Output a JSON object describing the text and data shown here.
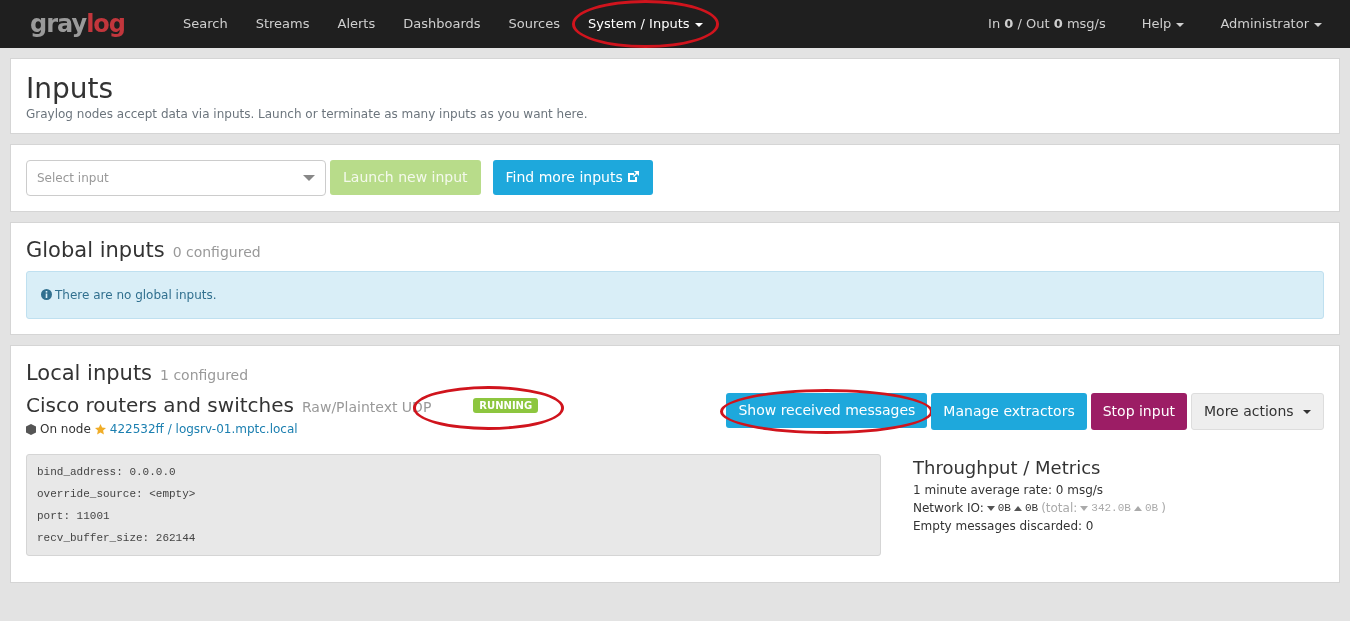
{
  "navbar": {
    "logo_parts": [
      "gray",
      "log"
    ],
    "items": [
      {
        "label": "Search",
        "selected": false,
        "highlighted": false,
        "dropdown": false
      },
      {
        "label": "Streams",
        "selected": false,
        "highlighted": false,
        "dropdown": false
      },
      {
        "label": "Alerts",
        "selected": false,
        "highlighted": false,
        "dropdown": false
      },
      {
        "label": "Dashboards",
        "selected": false,
        "highlighted": false,
        "dropdown": false
      },
      {
        "label": "Sources",
        "selected": false,
        "highlighted": false,
        "dropdown": false
      },
      {
        "label": "System / Inputs",
        "selected": true,
        "highlighted": true,
        "dropdown": true
      }
    ],
    "throughput": "In **0** / Out **0** msg/s",
    "right_items": [
      {
        "label": "Help",
        "dropdown": true
      },
      {
        "label": "Administrator",
        "dropdown": true
      }
    ]
  },
  "header": {
    "title": "Inputs",
    "description": "Graylog nodes accept data via inputs. Launch or terminate as many inputs as you want here."
  },
  "launch": {
    "select_placeholder": "Select input",
    "launch_button": {
      "label": "Launch new input",
      "disabled": true
    },
    "find_button": {
      "label": "Find more inputs"
    }
  },
  "global_inputs": {
    "title": "Global inputs",
    "count": "0 configured",
    "info": "There are no global inputs."
  },
  "local_inputs": {
    "title": "Local inputs",
    "count": "1 configured",
    "inputs": [
      {
        "name": "Cisco routers and switches",
        "type": "Raw/Plaintext UDP",
        "status": "RUNNING",
        "status_highlighted": true,
        "node_label": "On node",
        "node_link": "422532ff / logsrv-01.mptc.local",
        "actions": [
          {
            "label": "Show received messages",
            "kind": "info",
            "highlighted": true,
            "dropdown": false
          },
          {
            "label": "Manage extractors",
            "kind": "info",
            "highlighted": false,
            "dropdown": false
          },
          {
            "label": "Stop input",
            "kind": "danger",
            "highlighted": false,
            "dropdown": false
          },
          {
            "label": "More actions",
            "kind": "default",
            "highlighted": false,
            "dropdown": true
          }
        ],
        "config": [
          "bind_address: 0.0.0.0",
          "override_source: <empty>",
          "port: 11001",
          "recv_buffer_size: 262144"
        ],
        "metrics": {
          "title": "Throughput / Metrics",
          "rate": "1 minute average rate: 0 msg/s",
          "network_label": "Network IO:",
          "rx": "0B",
          "tx": "0B",
          "total_label": "(total:",
          "total_rx": "342.0B",
          "total_tx": "0B",
          "total_end": ")",
          "discarded": "Empty messages discarded: 0"
        }
      }
    ]
  }
}
